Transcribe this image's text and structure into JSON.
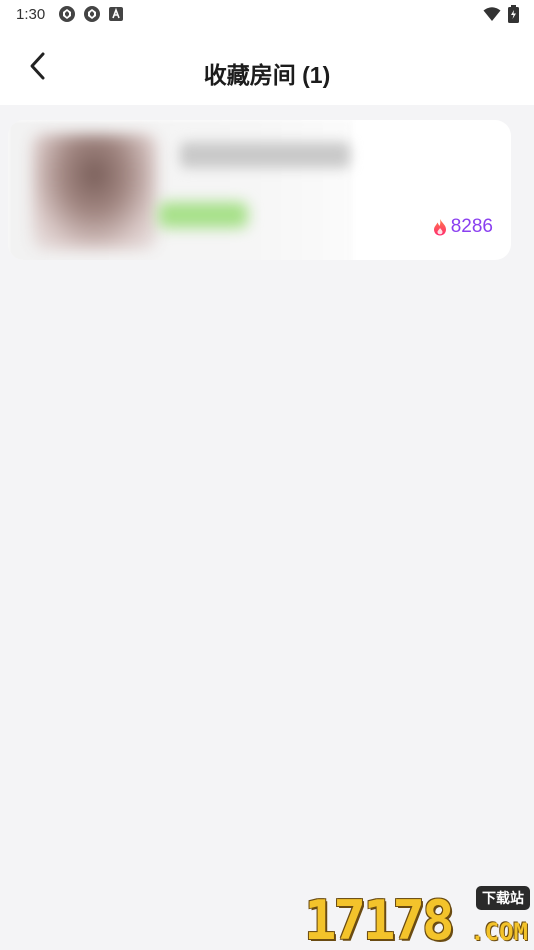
{
  "status_bar": {
    "time": "1:30",
    "icons": [
      "aperture-icon",
      "aperture-icon",
      "font-a-icon",
      "wifi-icon",
      "battery-icon"
    ]
  },
  "header": {
    "back_icon": "chevron-left-icon",
    "title": "收藏房间 (1)"
  },
  "rooms": [
    {
      "hot_count": "8286",
      "hot_icon": "flame-icon"
    }
  ],
  "watermark": {
    "digits": "17178",
    "com": ".COM",
    "badge": "下载站"
  },
  "colors": {
    "background": "#f4f4f6",
    "hot_count": "#8a3ff0",
    "flame": "#ff4f7a"
  }
}
